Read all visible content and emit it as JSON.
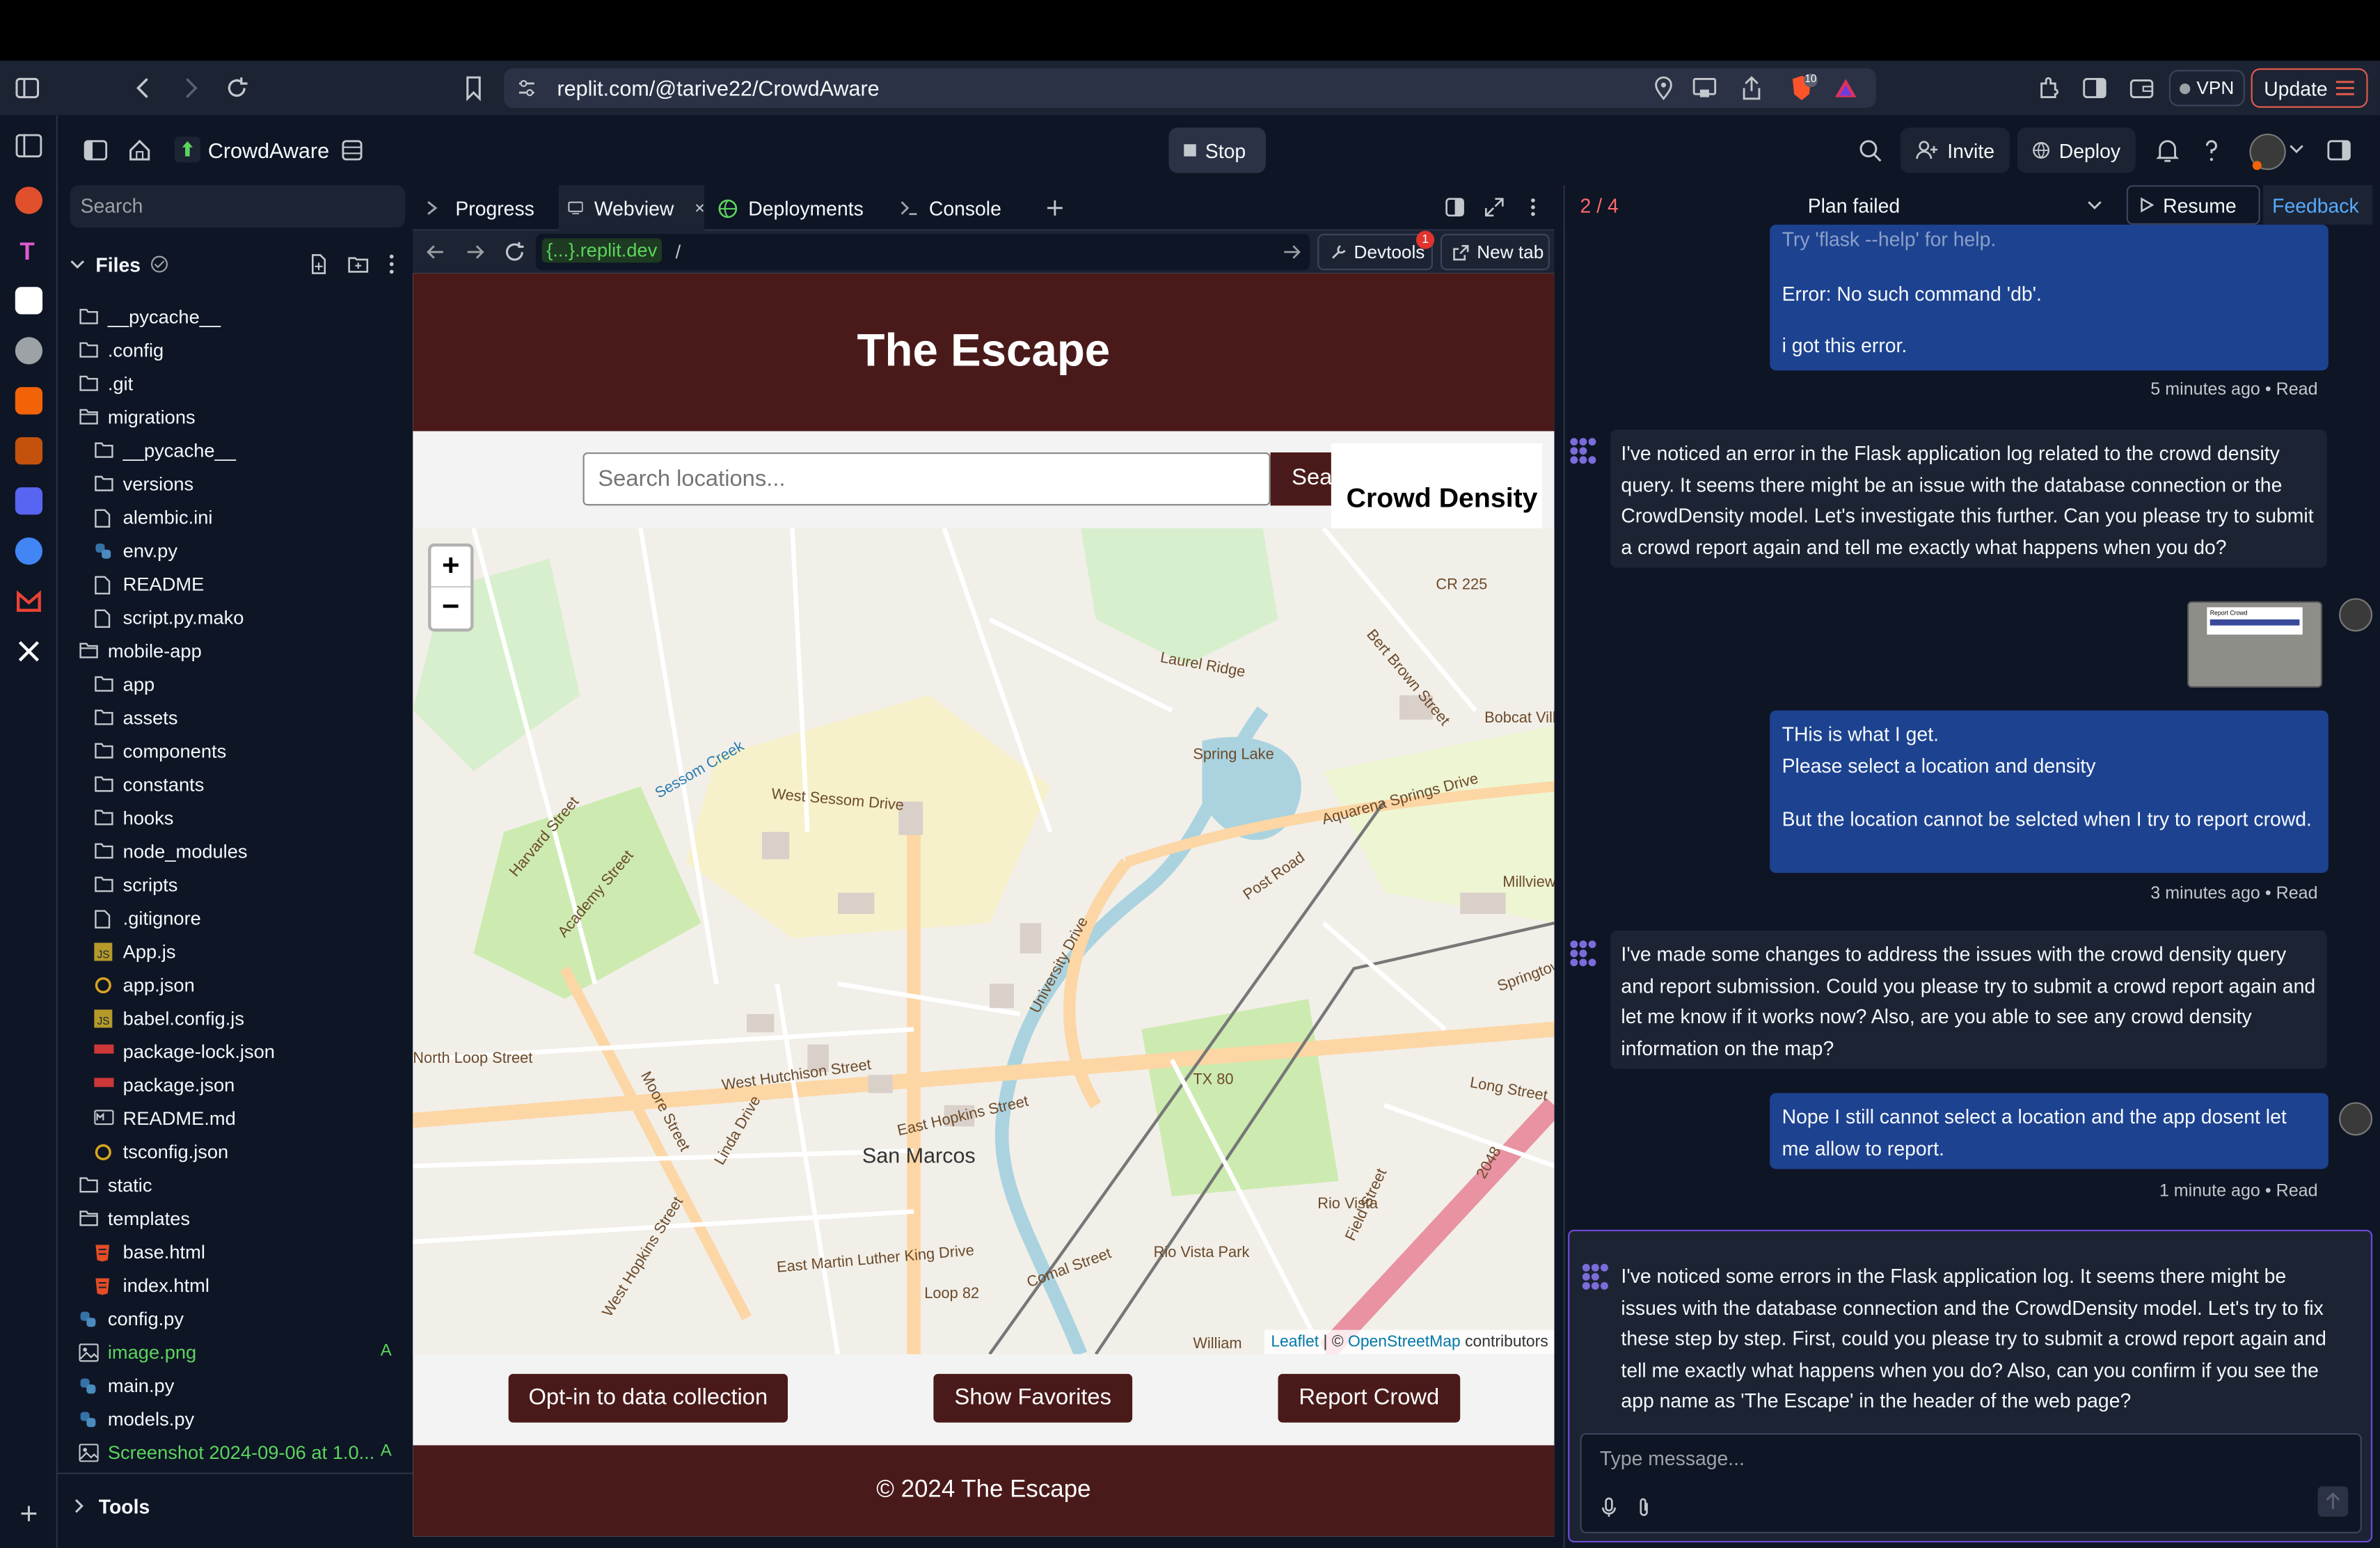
{
  "browser": {
    "url": "replit.com/@tarive22/CrowdAware",
    "brave_count": "10",
    "vpn_label": "VPN",
    "update_label": "Update"
  },
  "header": {
    "project_name": "CrowdAware",
    "stop_label": "Stop",
    "invite_label": "Invite",
    "deploy_label": "Deploy"
  },
  "sidebar": {
    "search_placeholder": "Search",
    "files_label": "Files",
    "tools_label": "Tools",
    "items": [
      {
        "name": "__pycache__",
        "type": "folder",
        "indent": 0
      },
      {
        "name": ".config",
        "type": "folder",
        "indent": 0
      },
      {
        "name": ".git",
        "type": "folder",
        "indent": 0
      },
      {
        "name": "migrations",
        "type": "folder-open",
        "indent": 0
      },
      {
        "name": "__pycache__",
        "type": "folder",
        "indent": 1
      },
      {
        "name": "versions",
        "type": "folder",
        "indent": 1
      },
      {
        "name": "alembic.ini",
        "type": "file",
        "indent": 1
      },
      {
        "name": "env.py",
        "type": "python",
        "indent": 1
      },
      {
        "name": "README",
        "type": "file",
        "indent": 1
      },
      {
        "name": "script.py.mako",
        "type": "file",
        "indent": 1
      },
      {
        "name": "mobile-app",
        "type": "folder-open",
        "indent": 0
      },
      {
        "name": "app",
        "type": "folder",
        "indent": 1
      },
      {
        "name": "assets",
        "type": "folder",
        "indent": 1
      },
      {
        "name": "components",
        "type": "folder",
        "indent": 1
      },
      {
        "name": "constants",
        "type": "folder",
        "indent": 1
      },
      {
        "name": "hooks",
        "type": "folder",
        "indent": 1
      },
      {
        "name": "node_modules",
        "type": "folder",
        "indent": 1
      },
      {
        "name": "scripts",
        "type": "folder",
        "indent": 1
      },
      {
        "name": ".gitignore",
        "type": "file",
        "indent": 1
      },
      {
        "name": "App.js",
        "type": "js",
        "indent": 1
      },
      {
        "name": "app.json",
        "type": "json",
        "indent": 1
      },
      {
        "name": "babel.config.js",
        "type": "js",
        "indent": 1
      },
      {
        "name": "package-lock.json",
        "type": "npm",
        "indent": 1
      },
      {
        "name": "package.json",
        "type": "npm",
        "indent": 1
      },
      {
        "name": "README.md",
        "type": "md",
        "indent": 1
      },
      {
        "name": "tsconfig.json",
        "type": "json",
        "indent": 1
      },
      {
        "name": "static",
        "type": "folder",
        "indent": 0
      },
      {
        "name": "templates",
        "type": "folder-open",
        "indent": 0
      },
      {
        "name": "base.html",
        "type": "html",
        "indent": 1
      },
      {
        "name": "index.html",
        "type": "html",
        "indent": 1
      },
      {
        "name": "config.py",
        "type": "python",
        "indent": 0
      },
      {
        "name": "image.png",
        "type": "image",
        "indent": 0,
        "badge": "A"
      },
      {
        "name": "main.py",
        "type": "python",
        "indent": 0
      },
      {
        "name": "models.py",
        "type": "python",
        "indent": 0
      },
      {
        "name": "Screenshot 2024-09-06 at 1.0...",
        "type": "image",
        "indent": 0,
        "badge": "A"
      }
    ]
  },
  "tabs": {
    "items": [
      "Progress",
      "Webview",
      "Deployments",
      "Console"
    ]
  },
  "webview_nav": {
    "domain": "{...}.replit.dev",
    "path": "/",
    "devtools_label": "Devtools",
    "devtools_badge": "1",
    "newtab_label": "New tab"
  },
  "app": {
    "title": "The Escape",
    "search_placeholder": "Search locations...",
    "search_button": "Sea",
    "crowd_density_label": "Crowd Density",
    "zoom_in": "+",
    "zoom_out": "−",
    "attribution_leaflet": "Leaflet",
    "attribution_sep": " | © ",
    "attribution_osm": "OpenStreetMap",
    "attribution_tail": " contributors",
    "btn_optin": "Opt-in to data collection",
    "btn_favorites": "Show Favorites",
    "btn_report": "Report Crowd",
    "footer": "© 2024 The Escape"
  },
  "map_labels": {
    "city": "San Marcos",
    "streets": [
      "University Drive",
      "East Hopkins Street",
      "Aquarena Springs Drive",
      "Post Road",
      "Moore Street",
      "West Hopkins Street",
      "Loop 82",
      "CR 225",
      "TX 80",
      "Rio Vista",
      "Rio Vista Park",
      "Millview",
      "Springtown",
      "Bobcat Village",
      "Spring Lake",
      "North Loop Street",
      "Sessom Creek",
      "West Sessom Drive",
      "Harvard Street",
      "Academy Street",
      "Long Street",
      "2048",
      "William",
      "Field Street",
      "Comal Street",
      "East Martin Luther King Drive",
      "West Hutchison Street",
      "Linda Drive",
      "Laurel Ridge",
      "Bert Brown Street"
    ]
  },
  "chat": {
    "plan_progress": "2 / 4",
    "plan_status": "Plan failed",
    "resume_label": "Resume",
    "feedback_label": "Feedback",
    "msg1_truncated": "Try 'flask --help' for help.",
    "msg1_line1": "Error: No such command 'db'.",
    "msg1_line2": "i got this error.",
    "msg1_meta": "5 minutes ago • Read",
    "ai1": "I've noticed an error in the Flask application log related to the crowd density query. It seems there might be an issue with the database connection or the CrowdDensity model. Let's investigate this further. Can you please try to submit a crowd report again and tell me exactly what happens when you do?",
    "img_thumb_title": "Report Crowd",
    "msg2_line1": "THis is what I get.",
    "msg2_line2": "Please select a location and density",
    "msg2_line3": "But the location cannot be selcted when I try to report crowd.",
    "msg2_meta": "3 minutes ago • Read",
    "ai2": "I've made some changes to address the issues with the crowd density query and report submission. Could you please try to submit a crowd report again and let me know if it works now? Also, are you able to see any crowd density information on the map?",
    "msg3": "Nope I still cannot select a location and the app dosent let me allow to report.",
    "msg3_meta": "1 minute ago • Read",
    "ai3": "I've noticed some errors in the Flask application log. It seems there might be issues with the database connection and the CrowdDensity model. Let's try to fix these step by step. First, could you please try to submit a crowd report again and tell me exactly what happens when you do? Also, can you confirm if you see the app name as 'The Escape' in the header of the web page?",
    "input_placeholder": "Type message..."
  },
  "colors": {
    "accent_orange": "#f26207",
    "maroon": "#4a1a1a",
    "user_bubble": "#1d4290",
    "panel": "#1c2333",
    "bg": "#0e1525",
    "feedback": "#57abff",
    "plan_failed_num": "#ff6b6b"
  }
}
